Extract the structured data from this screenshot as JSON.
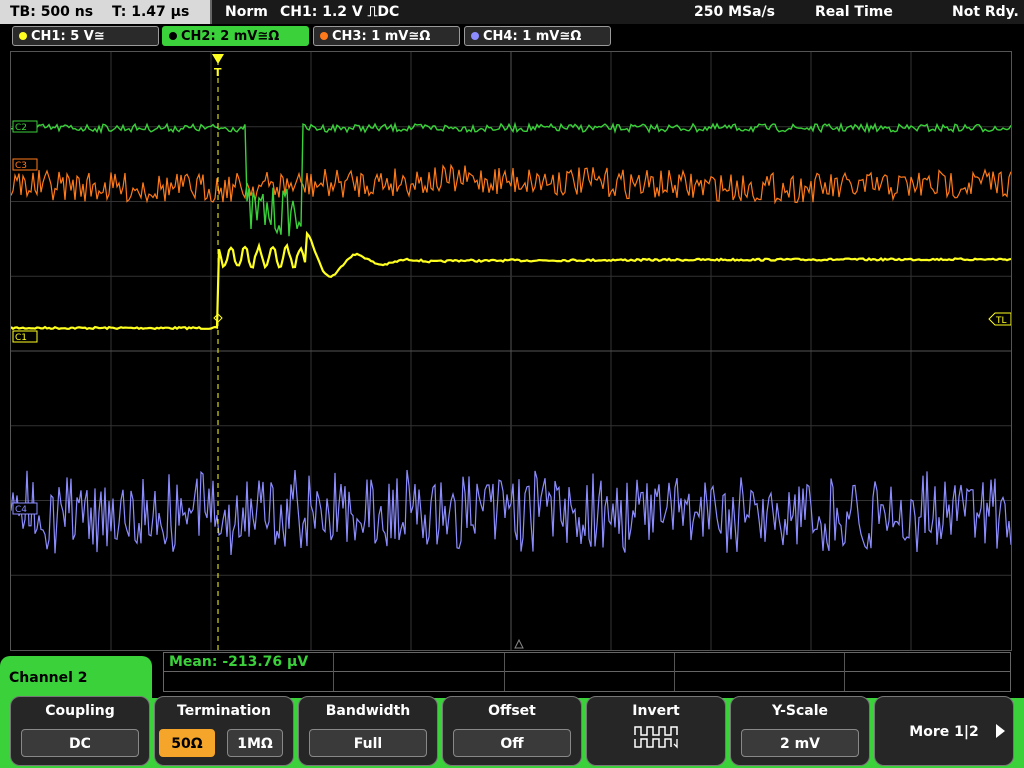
{
  "header": {
    "timebase": "TB: 500 ns",
    "trigger_time": "T: 1.47 µs",
    "mode": "Norm",
    "trigger_info": "CH1: 1.2 V ⎍DC",
    "sample_rate": "250 MSa/s",
    "acq_mode": "Real Time",
    "status": "Not Rdy."
  },
  "channels": [
    {
      "label": "CH1: 5 V≅",
      "color": "#ffff20",
      "active": false
    },
    {
      "label": "CH2: 2 mV≅Ω",
      "color": "#3ad13a",
      "active": true
    },
    {
      "label": "CH3: 1 mV≅Ω",
      "color": "#ff7a1a",
      "active": false
    },
    {
      "label": "CH4: 1 mV≅Ω",
      "color": "#8c8cff",
      "active": false
    }
  ],
  "plot": {
    "markers": {
      "c1": "C1",
      "c2": "C2",
      "c3": "C3",
      "c4": "C4",
      "trigger": "T",
      "trigger_level": "TL"
    }
  },
  "measurement": {
    "text": "Mean: -213.76 µV"
  },
  "menu": {
    "title": "Channel 2",
    "coupling": {
      "label": "Coupling",
      "value": "DC"
    },
    "termination": {
      "label": "Termination",
      "opt1": "50Ω",
      "opt2": "1MΩ",
      "selected": "50Ω"
    },
    "bandwidth": {
      "label": "Bandwidth",
      "value": "Full"
    },
    "offset": {
      "label": "Offset",
      "value": "Off"
    },
    "invert": {
      "label": "Invert"
    },
    "yscale": {
      "label": "Y-Scale",
      "value": "2 mV"
    },
    "more": {
      "label": "More 1|2"
    }
  },
  "colors": {
    "ch1": "#ffff20",
    "ch2": "#3ad13a",
    "ch3": "#ff7a1a",
    "ch4": "#8c8cff",
    "accent": "#3ad13a",
    "selected": "#f4a52a"
  }
}
